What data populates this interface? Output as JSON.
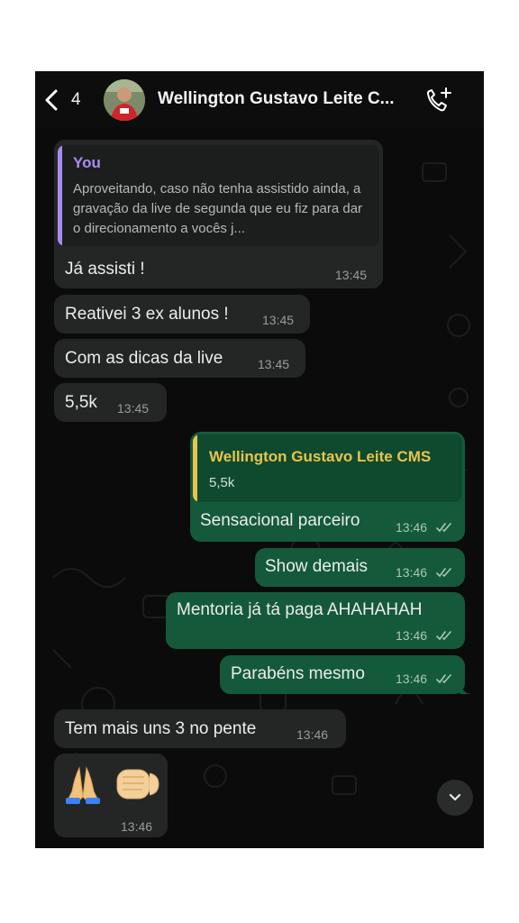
{
  "header": {
    "back_count": "4",
    "contact_name": "Wellington Gustavo Leite C...",
    "icons": [
      "chevron-left-icon",
      "add-call-icon",
      "avatar"
    ]
  },
  "messages": {
    "m1": {
      "quote_author": "You",
      "quote_text": "Aproveitando, caso não tenha assistido ainda, a gravação da live de segunda que eu fiz para dar o direcionamento a vocês j...",
      "text": "Já assisti !",
      "time": "13:45"
    },
    "m2": {
      "text": "Reativei 3 ex alunos !",
      "time": "13:45"
    },
    "m3": {
      "text": "Com as dicas da live",
      "time": "13:45"
    },
    "m4": {
      "text": "5,5k",
      "time": "13:45"
    },
    "m5": {
      "quote_author": "Wellington Gustavo Leite CMS",
      "quote_text": "5,5k",
      "text": "Sensacional parceiro",
      "time": "13:46"
    },
    "m6": {
      "text": "Show demais",
      "time": "13:46"
    },
    "m7": {
      "text": "Mentoria já tá paga AHAHAHAH",
      "time": "13:46"
    },
    "m8": {
      "text": "Parabéns mesmo",
      "time": "13:46"
    },
    "m9": {
      "text": "Tem mais uns 3 no pente",
      "time": "13:46"
    },
    "m10": {
      "emoji": [
        "praying-hands",
        "fist-bump"
      ],
      "time": "13:46"
    }
  },
  "colors": {
    "incoming_bubble": "#242626",
    "outgoing_bubble": "#145a3a",
    "quote_you": "#a98bf0",
    "quote_contact": "#e8c44a",
    "read_ticks": "#a9c8b6"
  }
}
